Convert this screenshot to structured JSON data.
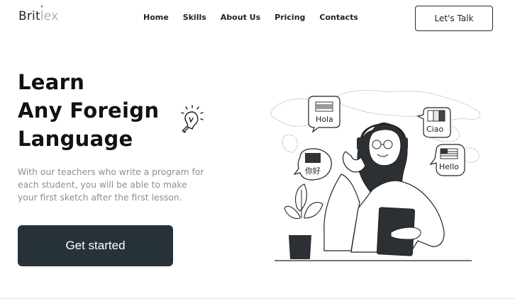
{
  "brand": {
    "part1": "Brit",
    "part2": "lex"
  },
  "nav": [
    {
      "label": "Home"
    },
    {
      "label": "Skills"
    },
    {
      "label": "About Us"
    },
    {
      "label": "Pricing"
    },
    {
      "label": "Contacts"
    }
  ],
  "header": {
    "cta_label": "Let's Talk"
  },
  "hero": {
    "headline_line1": "Learn",
    "headline_line2": "Any Foreign",
    "headline_line3": "Language",
    "description": "With our teachers who write a program for each student, you will be able to make your first sketch after the first lesson.",
    "button_label": "Get started"
  },
  "illustration": {
    "bubbles": [
      {
        "text": "Hola",
        "flag": "spain"
      },
      {
        "text": "Ciao",
        "flag": "italy"
      },
      {
        "text": "你好",
        "flag": "china"
      },
      {
        "text": "Hello",
        "flag": "usa"
      }
    ]
  },
  "colors": {
    "accent": "#273238",
    "text_muted": "#8a8f94"
  },
  "icons": [
    "lightbulb-icon"
  ]
}
